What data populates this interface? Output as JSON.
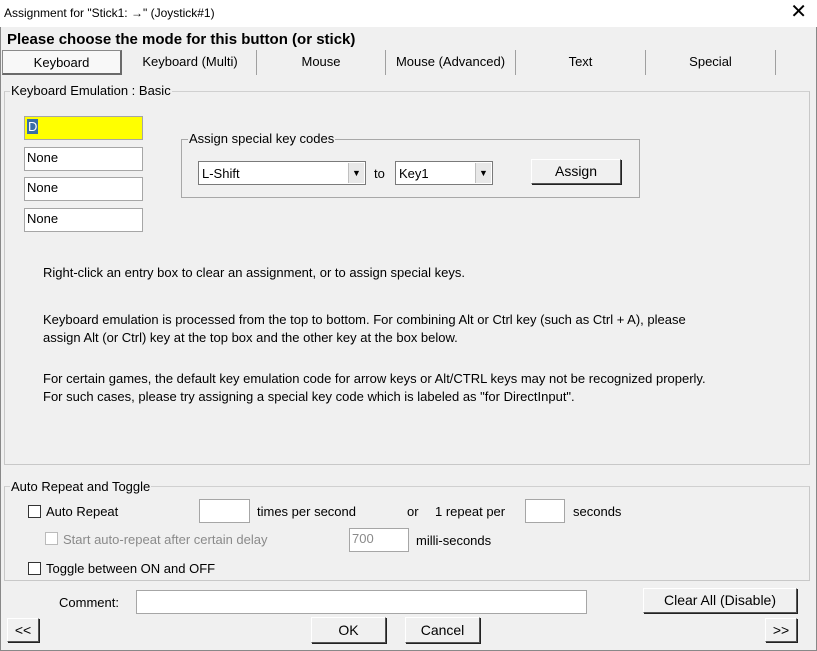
{
  "window": {
    "title": "Assignment for \"Stick1: →\" (Joystick#1)",
    "close_glyph": "✕"
  },
  "heading": "Please choose the mode for this button (or stick)",
  "tabs": [
    {
      "label": "Keyboard"
    },
    {
      "label": "Keyboard (Multi)"
    },
    {
      "label": "Mouse"
    },
    {
      "label": "Mouse (Advanced)"
    },
    {
      "label": "Text"
    },
    {
      "label": "Special"
    }
  ],
  "keyboard_group": {
    "label": "Keyboard Emulation : Basic",
    "entries": [
      "D",
      "None",
      "None",
      "None"
    ],
    "special": {
      "label": "Assign special key codes",
      "key_value": "L-Shift",
      "to_label": "to",
      "target_value": "Key1",
      "assign_label": "Assign"
    },
    "info": [
      "Right-click an entry box to clear an assignment, or to assign special keys.",
      "Keyboard emulation is processed from the top to bottom.  For combining Alt or Ctrl key (such as Ctrl + A), please",
      "assign Alt (or Ctrl) key at the top box and the other key at the box below.",
      "For certain games, the default key emulation code for arrow keys or Alt/CTRL keys may not be recognized properly.",
      "For such cases, please try assigning a special key code which is labeled as \"for DirectInput\"."
    ]
  },
  "repeat_group": {
    "label": "Auto Repeat and Toggle",
    "auto_repeat": "Auto Repeat",
    "times_value": "",
    "times_label": "times per second",
    "or_label": "or",
    "per_label": "1 repeat per",
    "seconds_value": "",
    "seconds_label": "seconds",
    "delay_label": "Start auto-repeat after certain delay",
    "delay_value": "700",
    "ms_label": "milli-seconds",
    "toggle_label": "Toggle between ON and OFF"
  },
  "comment": {
    "label": "Comment:",
    "value": ""
  },
  "buttons": {
    "clear_all": "Clear All (Disable)",
    "prev": "<<",
    "ok": "OK",
    "cancel": "Cancel",
    "next": ">>"
  }
}
